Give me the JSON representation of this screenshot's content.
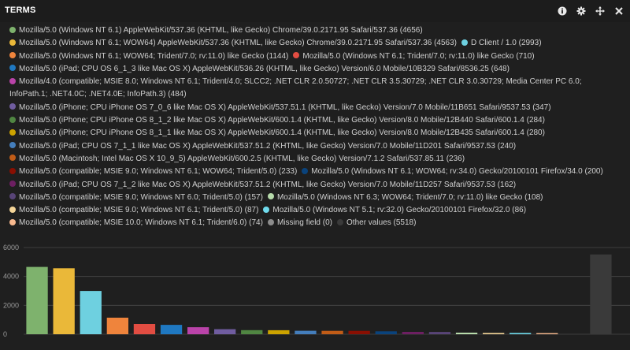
{
  "panel": {
    "title": "TERMS",
    "icons": [
      "info-icon",
      "gear-icon",
      "move-icon",
      "close-icon"
    ]
  },
  "chart_data": {
    "type": "bar",
    "ylim": [
      0,
      6000
    ],
    "yticks": [
      0,
      2000,
      4000,
      6000
    ],
    "grid": true,
    "legend_placement": "top",
    "series": [
      {
        "name": "Mozilla/5.0 (Windows NT 6.1) AppleWebKit/537.36 (KHTML, like Gecko) Chrome/39.0.2171.95 Safari/537.36",
        "value": 4656,
        "color": "#7eb26d"
      },
      {
        "name": "Mozilla/5.0 (Windows NT 6.1; WOW64) AppleWebKit/537.36 (KHTML, like Gecko) Chrome/39.0.2171.95 Safari/537.36",
        "value": 4563,
        "color": "#eab839"
      },
      {
        "name": "D Client / 1.0",
        "value": 2993,
        "color": "#6ed0e0"
      },
      {
        "name": "Mozilla/5.0 (Windows NT 6.1; WOW64; Trident/7.0; rv:11.0) like Gecko",
        "value": 1144,
        "color": "#ef843c"
      },
      {
        "name": "Mozilla/5.0 (Windows NT 6.1; Trident/7.0; rv:11.0) like Gecko",
        "value": 710,
        "color": "#e24d42"
      },
      {
        "name": "Mozilla/5.0 (iPad; CPU OS 6_1_3 like Mac OS X) AppleWebKit/536.26 (KHTML, like Gecko) Version/6.0 Mobile/10B329 Safari/8536.25",
        "value": 648,
        "color": "#1f78c1"
      },
      {
        "name": "Mozilla/4.0 (compatible; MSIE 8.0; Windows NT 6.1; Trident/4.0; SLCC2; .NET CLR 2.0.50727; .NET CLR 3.5.30729; .NET CLR 3.0.30729; Media Center PC 6.0; InfoPath.1; .NET4.0C; .NET4.0E; InfoPath.3)",
        "value": 484,
        "color": "#ba43a9"
      },
      {
        "name": "Mozilla/5.0 (iPhone; CPU iPhone OS 7_0_6 like Mac OS X) AppleWebKit/537.51.1 (KHTML, like Gecko) Version/7.0 Mobile/11B651 Safari/9537.53",
        "value": 347,
        "color": "#705da0"
      },
      {
        "name": "Mozilla/5.0 (iPhone; CPU iPhone OS 8_1_2 like Mac OS X) AppleWebKit/600.1.4 (KHTML, like Gecko) Version/8.0 Mobile/12B440 Safari/600.1.4",
        "value": 284,
        "color": "#508642"
      },
      {
        "name": "Mozilla/5.0 (iPhone; CPU iPhone OS 8_1_1 like Mac OS X) AppleWebKit/600.1.4 (KHTML, like Gecko) Version/8.0 Mobile/12B435 Safari/600.1.4",
        "value": 280,
        "color": "#cca300"
      },
      {
        "name": "Mozilla/5.0 (iPad; CPU OS 7_1_1 like Mac OS X) AppleWebKit/537.51.2 (KHTML, like Gecko) Version/7.0 Mobile/11D201 Safari/9537.53",
        "value": 240,
        "color": "#447ebc"
      },
      {
        "name": "Mozilla/5.0 (Macintosh; Intel Mac OS X 10_9_5) AppleWebKit/600.2.5 (KHTML, like Gecko) Version/7.1.2 Safari/537.85.11",
        "value": 236,
        "color": "#c15c17"
      },
      {
        "name": "Mozilla/5.0 (compatible; MSIE 9.0; Windows NT 6.1; WOW64; Trident/5.0)",
        "value": 233,
        "color": "#890f02"
      },
      {
        "name": "Mozilla/5.0 (Windows NT 6.1; WOW64; rv:34.0) Gecko/20100101 Firefox/34.0",
        "value": 200,
        "color": "#0a437c"
      },
      {
        "name": "Mozilla/5.0 (iPad; CPU OS 7_1_2 like Mac OS X) AppleWebKit/537.51.2 (KHTML, like Gecko) Version/7.0 Mobile/11D257 Safari/9537.53",
        "value": 162,
        "color": "#6d1f62"
      },
      {
        "name": "Mozilla/5.0 (compatible; MSIE 9.0; Windows NT 6.0; Trident/5.0)",
        "value": 157,
        "color": "#584477"
      },
      {
        "name": "Mozilla/5.0 (Windows NT 6.3; WOW64; Trident/7.0; rv:11.0) like Gecko",
        "value": 108,
        "color": "#b7dbab"
      },
      {
        "name": "Mozilla/5.0 (compatible; MSIE 9.0; Windows NT 6.1; Trident/5.0)",
        "value": 87,
        "color": "#f4d598"
      },
      {
        "name": "Mozilla/5.0 (Windows NT 5.1; rv:32.0) Gecko/20100101 Firefox/32.0",
        "value": 86,
        "color": "#70dbed"
      },
      {
        "name": "Mozilla/5.0 (compatible; MSIE 10.0; Windows NT 6.1; Trident/6.0)",
        "value": 74,
        "color": "#f9ba8f"
      },
      {
        "name": "Missing field",
        "value": 0,
        "color": "#8c8c8c"
      },
      {
        "name": "Other values",
        "value": 5518,
        "color": "#3a3a3a"
      }
    ],
    "legend_rows": [
      [
        0
      ],
      [
        1,
        2
      ],
      [
        3,
        4
      ],
      [
        5
      ],
      [
        6
      ],
      [
        7
      ],
      [
        8
      ],
      [
        9
      ],
      [
        10
      ],
      [
        11
      ],
      [
        12,
        13
      ],
      [
        14
      ],
      [
        15,
        16
      ],
      [
        17,
        18
      ],
      [
        19,
        20,
        21
      ]
    ]
  }
}
